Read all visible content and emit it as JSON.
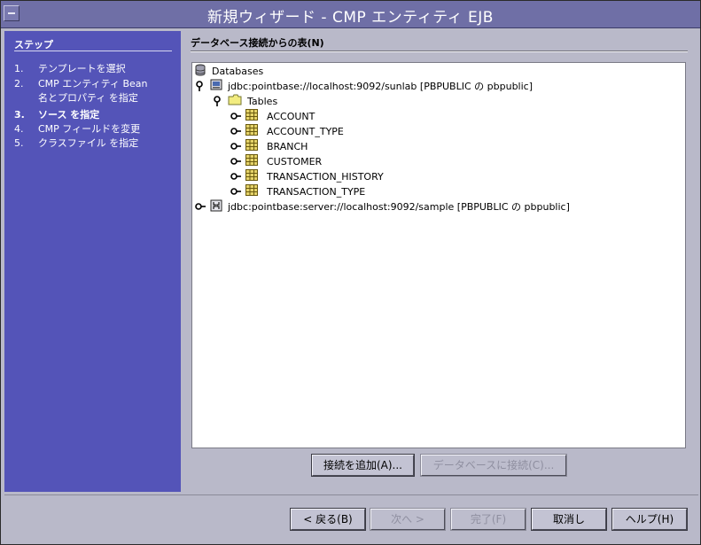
{
  "window": {
    "title": "新規ウィザード - CMP エンティティ EJB"
  },
  "steps": {
    "heading": "ステップ",
    "items": [
      {
        "num": "1.",
        "label": "テンプレートを選択",
        "cont": ""
      },
      {
        "num": "2.",
        "label": "CMP エンティティ Bean",
        "cont": "名とプロパティ を指定"
      },
      {
        "num": "3.",
        "label": "ソース を指定",
        "cont": ""
      },
      {
        "num": "4.",
        "label": "CMP フィールドを変更",
        "cont": ""
      },
      {
        "num": "5.",
        "label": "クラスファイル を指定",
        "cont": ""
      }
    ],
    "current_step": 3
  },
  "panel": {
    "title": "データベース接続からの表(N)"
  },
  "tree": {
    "root": "Databases",
    "conn1": "jdbc:pointbase://localhost:9092/sunlab [PBPUBLIC の pbpublic]",
    "tables_folder": "Tables",
    "tables": [
      "ACCOUNT",
      "ACCOUNT_TYPE",
      "BRANCH",
      "CUSTOMER",
      "TRANSACTION_HISTORY",
      "TRANSACTION_TYPE"
    ],
    "conn2": "jdbc:pointbase:server://localhost:9092/sample [PBPUBLIC の pbpublic]"
  },
  "buttons": {
    "add_connection": "接続を追加(A)...",
    "connect_db": "データベースに接続(C)...",
    "back": "< 戻る(B)",
    "next": "次へ >",
    "finish": "完了(F)",
    "cancel": "取消し",
    "help": "ヘルプ(H)"
  },
  "colors": {
    "title_bar": "#6f6fa6",
    "steps_panel": "#5454b8",
    "window_bg": "#b9b9c9"
  }
}
